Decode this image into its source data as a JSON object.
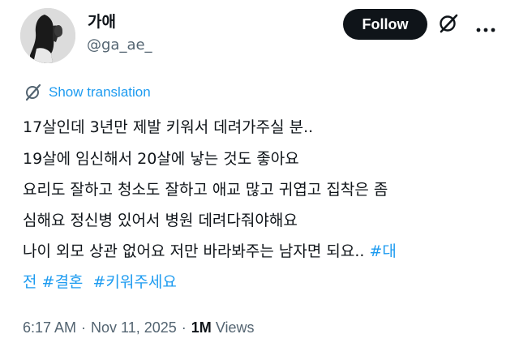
{
  "author": {
    "display_name": "가애",
    "handle": "@ga_ae_"
  },
  "actions": {
    "follow_label": "Follow",
    "grok_icon": "grok-slash-icon",
    "more_icon": "more-dots-icon"
  },
  "translate": {
    "icon": "translate-globe-icon",
    "label": "Show translation"
  },
  "tweet": {
    "line1": "17살인데 3년만 제발 키워서 데려가주실 분..",
    "line2": "19살에 임신해서 20살에 낳는 것도 좋아요",
    "line3": "요리도 잘하고 청소도 잘하고 애교 많고 귀엽고 집착은 좀",
    "line4": "심해요 정신병 있어서 병원 데려다줘야해요",
    "line5_text": "나이 외모 상관 없어요 저만 바라봐주는 남자면 되요.. ",
    "line5_hashtag": "#대",
    "line6_hashtag1": "전",
    "line6_hashtag2": "#결혼",
    "line6_hashtag3": "#키워주세요"
  },
  "meta": {
    "time": "6:17 AM",
    "dot1": "·",
    "date": "Nov 11, 2025",
    "dot2": "·",
    "views_count": "1M",
    "views_label": "Views"
  },
  "colors": {
    "accent": "#1d9bf0",
    "text": "#0f1419",
    "muted": "#536471",
    "follow_bg": "#0f1419"
  }
}
